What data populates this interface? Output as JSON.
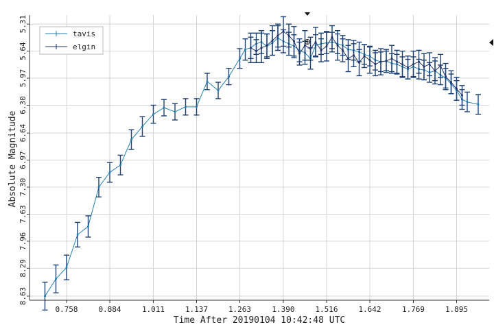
{
  "chart_data": {
    "type": "line",
    "title": "",
    "xlabel": "Time After 20190104 10:42:48 UTC",
    "ylabel": "Absolute Magnitude",
    "y_inverted": true,
    "xlim": [
      0.65,
      1.99
    ],
    "ylim": [
      5.2,
      8.68
    ],
    "x_ticks": [
      0.758,
      0.884,
      1.011,
      1.137,
      1.263,
      1.39,
      1.516,
      1.642,
      1.769,
      1.895
    ],
    "x_tick_labels": [
      "0.758",
      "0.884",
      "1.011",
      "1.137",
      "1.263",
      "1.390",
      "1.516",
      "1.642",
      "1.769",
      "1.895"
    ],
    "y_ticks": [
      5.31,
      5.64,
      5.97,
      6.3,
      6.64,
      6.97,
      7.3,
      7.63,
      7.96,
      8.29,
      8.63
    ],
    "y_tick_labels": [
      "5.31",
      "5.64",
      "5.97",
      "6.30",
      "6.64",
      "6.97",
      "7.30",
      "7.63",
      "7.96",
      "8.29",
      "8.63"
    ],
    "grid": true,
    "legend_position": "top-left",
    "series": [
      {
        "name": "tavis",
        "color": "#1f7fb0",
        "x": [
          0.695,
          0.727,
          0.758,
          0.79,
          0.821,
          0.852,
          0.884,
          0.915,
          0.947,
          0.979,
          1.011,
          1.042,
          1.074,
          1.105,
          1.137,
          1.168,
          1.2,
          1.231,
          1.263,
          1.279,
          1.295,
          1.311,
          1.326,
          1.342,
          1.358,
          1.374,
          1.39,
          1.406,
          1.421,
          1.437,
          1.453,
          1.469,
          1.484,
          1.5,
          1.516,
          1.532,
          1.548,
          1.563,
          1.579,
          1.595,
          1.611,
          1.626,
          1.642,
          1.658,
          1.674,
          1.69,
          1.706,
          1.721,
          1.737,
          1.753,
          1.769,
          1.785,
          1.8,
          1.816,
          1.832,
          1.848,
          1.863,
          1.879,
          1.895,
          1.911,
          1.926,
          1.958
        ],
        "y": [
          8.63,
          8.42,
          8.28,
          7.88,
          7.78,
          7.3,
          7.12,
          7.03,
          6.72,
          6.56,
          6.41,
          6.33,
          6.38,
          6.32,
          6.32,
          6.01,
          6.12,
          5.95,
          5.73,
          5.62,
          5.6,
          5.55,
          5.53,
          5.58,
          5.54,
          5.48,
          5.52,
          5.55,
          5.58,
          5.63,
          5.66,
          5.73,
          5.57,
          5.55,
          5.54,
          5.53,
          5.55,
          5.57,
          5.62,
          5.63,
          5.65,
          5.68,
          5.7,
          5.75,
          5.77,
          5.76,
          5.79,
          5.8,
          5.83,
          5.86,
          5.83,
          5.86,
          5.87,
          5.9,
          5.88,
          5.93,
          5.97,
          6.04,
          6.12,
          6.23,
          6.26,
          6.29
        ],
        "errors": [
          0.17,
          0.17,
          0.15,
          0.15,
          0.13,
          0.12,
          0.12,
          0.12,
          0.12,
          0.12,
          0.11,
          0.1,
          0.1,
          0.1,
          0.1,
          0.1,
          0.1,
          0.1,
          0.12,
          0.13,
          0.13,
          0.13,
          0.14,
          0.15,
          0.15,
          0.15,
          0.14,
          0.14,
          0.14,
          0.14,
          0.14,
          0.13,
          0.13,
          0.13,
          0.13,
          0.12,
          0.12,
          0.12,
          0.12,
          0.12,
          0.12,
          0.12,
          0.12,
          0.12,
          0.12,
          0.12,
          0.12,
          0.12,
          0.12,
          0.12,
          0.12,
          0.12,
          0.12,
          0.12,
          0.12,
          0.12,
          0.12,
          0.12,
          0.12,
          0.12,
          0.12,
          0.12
        ]
      },
      {
        "name": "elgin",
        "color": "#223066",
        "x": [
          1.295,
          1.311,
          1.326,
          1.342,
          1.358,
          1.374,
          1.39,
          1.406,
          1.421,
          1.437,
          1.453,
          1.469,
          1.484,
          1.5,
          1.516,
          1.532,
          1.548,
          1.563,
          1.579,
          1.595,
          1.611,
          1.626,
          1.642,
          1.658,
          1.674,
          1.69,
          1.706,
          1.721,
          1.737,
          1.753,
          1.769,
          1.785,
          1.8,
          1.816,
          1.832,
          1.848,
          1.863,
          1.879,
          1.895,
          1.911
        ],
        "y": [
          5.6,
          5.64,
          5.6,
          5.57,
          5.51,
          5.45,
          5.4,
          5.45,
          5.52,
          5.67,
          5.57,
          5.61,
          5.53,
          5.63,
          5.58,
          5.47,
          5.57,
          5.63,
          5.73,
          5.69,
          5.78,
          5.7,
          5.75,
          5.8,
          5.77,
          5.76,
          5.73,
          5.77,
          5.8,
          5.84,
          5.8,
          5.77,
          5.83,
          5.8,
          5.88,
          5.82,
          5.95,
          6.02,
          6.1,
          6.18
        ],
        "errors": [
          0.18,
          0.14,
          0.18,
          0.14,
          0.18,
          0.14,
          0.18,
          0.14,
          0.18,
          0.14,
          0.18,
          0.14,
          0.18,
          0.14,
          0.18,
          0.14,
          0.18,
          0.14,
          0.16,
          0.14,
          0.16,
          0.14,
          0.16,
          0.14,
          0.16,
          0.14,
          0.16,
          0.14,
          0.16,
          0.14,
          0.16,
          0.14,
          0.16,
          0.14,
          0.16,
          0.14,
          0.16,
          0.14,
          0.14,
          0.12
        ]
      }
    ]
  }
}
